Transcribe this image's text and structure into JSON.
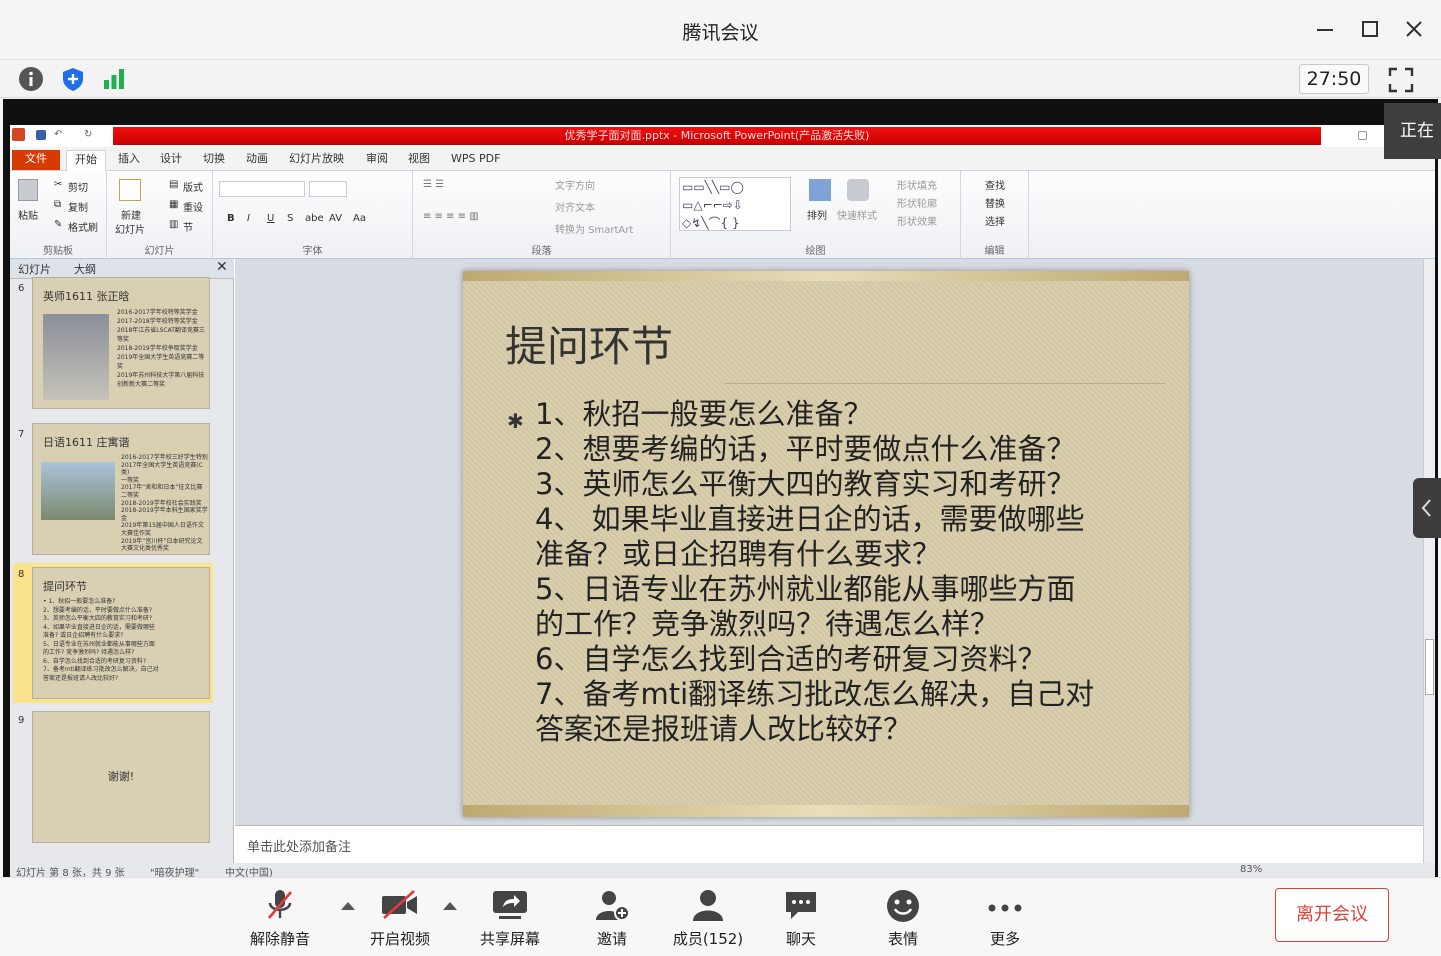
{
  "window": {
    "title": "腾讯会议"
  },
  "toolbar": {
    "timer": "27:50"
  },
  "ppt": {
    "window_title": "优秀学子面对面.pptx - Microsoft PowerPoint(产品激活失败)",
    "tabs": [
      "文件",
      "开始",
      "插入",
      "设计",
      "切换",
      "动画",
      "幻灯片放映",
      "审阅",
      "视图",
      "WPS PDF"
    ],
    "ribbon": {
      "clipboard": {
        "label": "剪贴板",
        "paste": "粘贴",
        "cut": "剪切",
        "copy": "复制",
        "format_painter": "格式刷"
      },
      "slides": {
        "label": "幻灯片",
        "new_slide_1": "新建",
        "new_slide_2": "幻灯片",
        "layout": "版式",
        "reset": "重设",
        "section": "节"
      },
      "font": {
        "label": "字体",
        "bold": "B",
        "italic": "I",
        "underline": "U",
        "strike": "S",
        "shadow": "abe",
        "spacing": "AV",
        "case": "Aa"
      },
      "paragraph": {
        "label": "段落",
        "text_direction": "文字方向",
        "align_text": "对齐文本",
        "smartart": "转换为 SmartArt"
      },
      "drawing": {
        "label": "绘图",
        "arrange": "排列",
        "quick_styles": "快速样式",
        "shape_fill": "形状填充",
        "shape_outline": "形状轮廓",
        "shape_effects": "形状效果"
      },
      "editing": {
        "label": "编辑",
        "find": "查找",
        "replace": "替换",
        "select": "选择"
      }
    },
    "panel_tabs": [
      "幻灯片",
      "大纲"
    ],
    "thumbnails": [
      {
        "num": "6",
        "title": "英师1611 张正晗",
        "lines": [
          "2016-2017学年校特等奖学金",
          "2017-2018学年校特等奖学金",
          "2018年江苏省LSCAT翻译竞赛三",
          "等奖",
          "2018-2019学年校争取奖学金",
          "2019年全国大学生英语竞赛二等",
          "奖",
          "2019年苏州科技大学第八届科技",
          "创新新大赛二等奖"
        ]
      },
      {
        "num": "7",
        "title": "日语1611 庄寓谐",
        "lines": [
          "2016-2017学年校三好学生特别",
          "2017年全国大学生英语竞赛(C类)",
          "一等奖",
          "2017年“舍和和日本”征文比赛",
          "二等奖",
          "2018-2019学年校社会实践奖",
          "2018-2019学年本科生国家奖学",
          "金",
          "2019年第15届中国人日语作文",
          "大赛佳作奖",
          "2019年“宫川杯”日本研究论文",
          "大赛文化类优秀奖"
        ]
      },
      {
        "num": "8",
        "title": "提问环节",
        "lines": [
          "• 1、秋招一般要怎么准备?",
          "2、想要考编的话，平时要做点什么准备?",
          "3、英师怎么平衡大四的教育实习和考研?",
          "4、如果毕业直接进日企的话，需要做哪些",
          "准备? 或日企招聘有什么要求?",
          "5、日语专业在苏州就业都能从事哪些方面",
          "的工作? 竞争激烈吗? 待遇怎么样?",
          "6、自学怎么找到合适的考研复习资料?",
          "7、备考mti翻译练习批改怎么解决，自己对",
          "答案还是报班请人改比较好?"
        ]
      },
      {
        "num": "9",
        "title": "谢谢!",
        "lines": []
      }
    ],
    "slide": {
      "title": "提问环节",
      "bullet": "✱",
      "lines": [
        "1、秋招一般要怎么准备？",
        "2、想要考编的话，平时要做点什么准备？",
        "3、英师怎么平衡大四的教育实习和考研？",
        "4、 如果毕业直接进日企的话，需要做哪些",
        "准备？或日企招聘有什么要求？",
        "5、日语专业在苏州就业都能从事哪些方面",
        "的工作？竞争激烈吗？待遇怎么样？",
        "6、自学怎么找到合适的考研复习资料？",
        "7、备考mti翻译练习批改怎么解决，自己对",
        "答案还是报班请人改比较好？"
      ]
    },
    "notes_placeholder": "单击此处添加备注",
    "status": {
      "slide_info": "幻灯片 第 8 张，共 9 张",
      "theme": "\"暗夜护理\"",
      "lang": "中文(中国)",
      "zoom": "83%"
    }
  },
  "sharing_label": "正在",
  "bottom": {
    "unmute": "解除静音",
    "start_video": "开启视频",
    "share_screen": "共享屏幕",
    "invite": "邀请",
    "members": "成员(152)",
    "chat": "聊天",
    "reactions": "表情",
    "more": "更多",
    "leave": "离开会议"
  },
  "colors": {
    "accent": "#1e6fe8",
    "leave": "#e0403a",
    "signal": "#20b050",
    "ppt_red": "#e01010"
  }
}
